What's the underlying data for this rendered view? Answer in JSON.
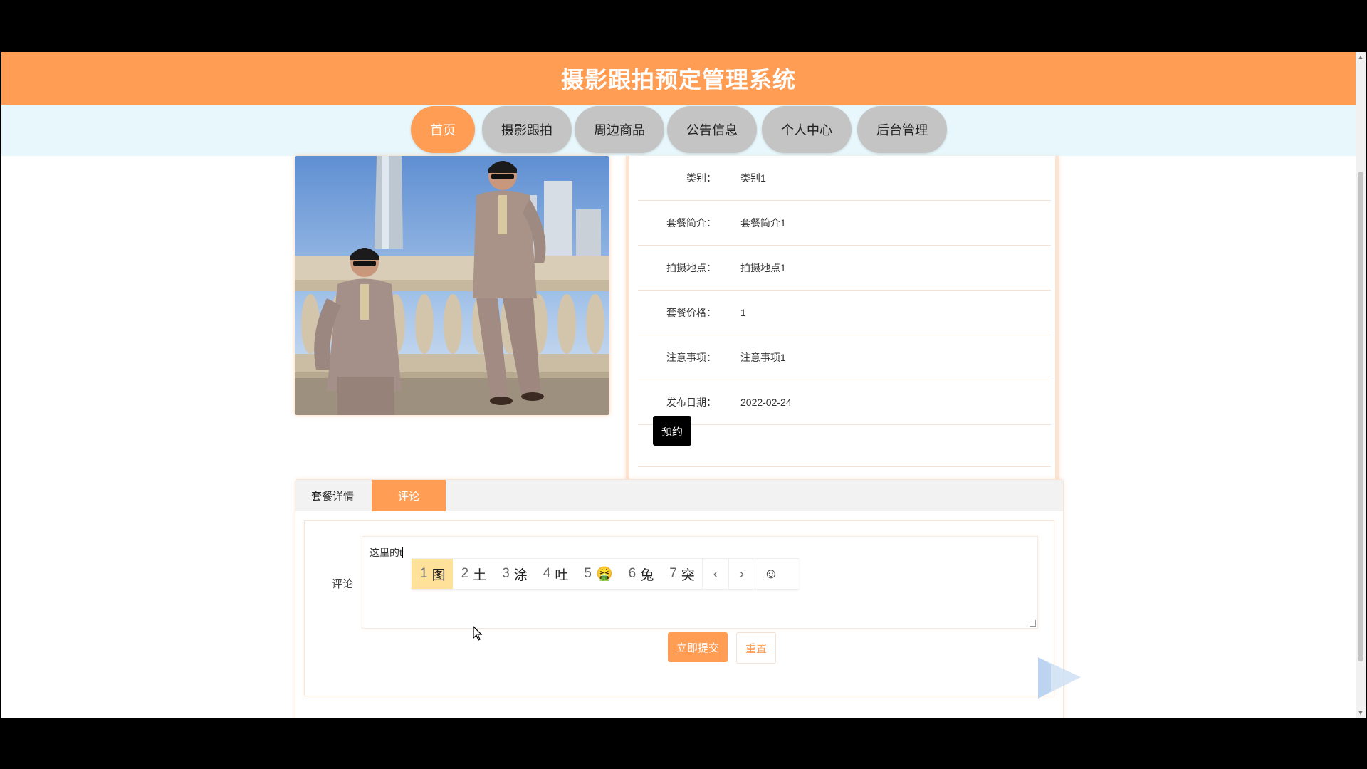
{
  "app": {
    "title": "摄影跟拍预定管理系统"
  },
  "nav": {
    "items": [
      {
        "label": "首页",
        "active": true
      },
      {
        "label": "摄影跟拍",
        "active": false
      },
      {
        "label": "周边商品",
        "active": false
      },
      {
        "label": "公告信息",
        "active": false
      },
      {
        "label": "个人中心",
        "active": false
      },
      {
        "label": "后台管理",
        "active": false
      }
    ]
  },
  "detail": {
    "rows": [
      {
        "label": "类别：",
        "value": "类别1"
      },
      {
        "label": "套餐简介：",
        "value": "套餐简介1"
      },
      {
        "label": "拍摄地点：",
        "value": "拍摄地点1"
      },
      {
        "label": "套餐价格：",
        "value": "1"
      },
      {
        "label": "注意事项：",
        "value": "注意事项1"
      },
      {
        "label": "发布日期：",
        "value": "2022-02-24"
      }
    ],
    "book_button": "预约"
  },
  "tabs": [
    {
      "label": "套餐详情",
      "active": false
    },
    {
      "label": "评论",
      "active": true
    }
  ],
  "comment": {
    "label": "评论",
    "text": "这里的t",
    "submit_label": "立即提交",
    "reset_label": "重置"
  },
  "ime": {
    "candidates": [
      {
        "num": "1",
        "text": "图",
        "selected": true
      },
      {
        "num": "2",
        "text": "土",
        "selected": false
      },
      {
        "num": "3",
        "text": "涂",
        "selected": false
      },
      {
        "num": "4",
        "text": "吐",
        "selected": false
      },
      {
        "num": "5",
        "text": "🤮",
        "selected": false
      },
      {
        "num": "6",
        "text": "兔",
        "selected": false
      },
      {
        "num": "7",
        "text": "突",
        "selected": false
      }
    ],
    "prev": "‹",
    "next": "›",
    "emoji": "☺"
  },
  "colors": {
    "accent": "#ff9d55",
    "nav_bg": "#e7f7fb",
    "nav_inactive": "#c4c4c4"
  }
}
